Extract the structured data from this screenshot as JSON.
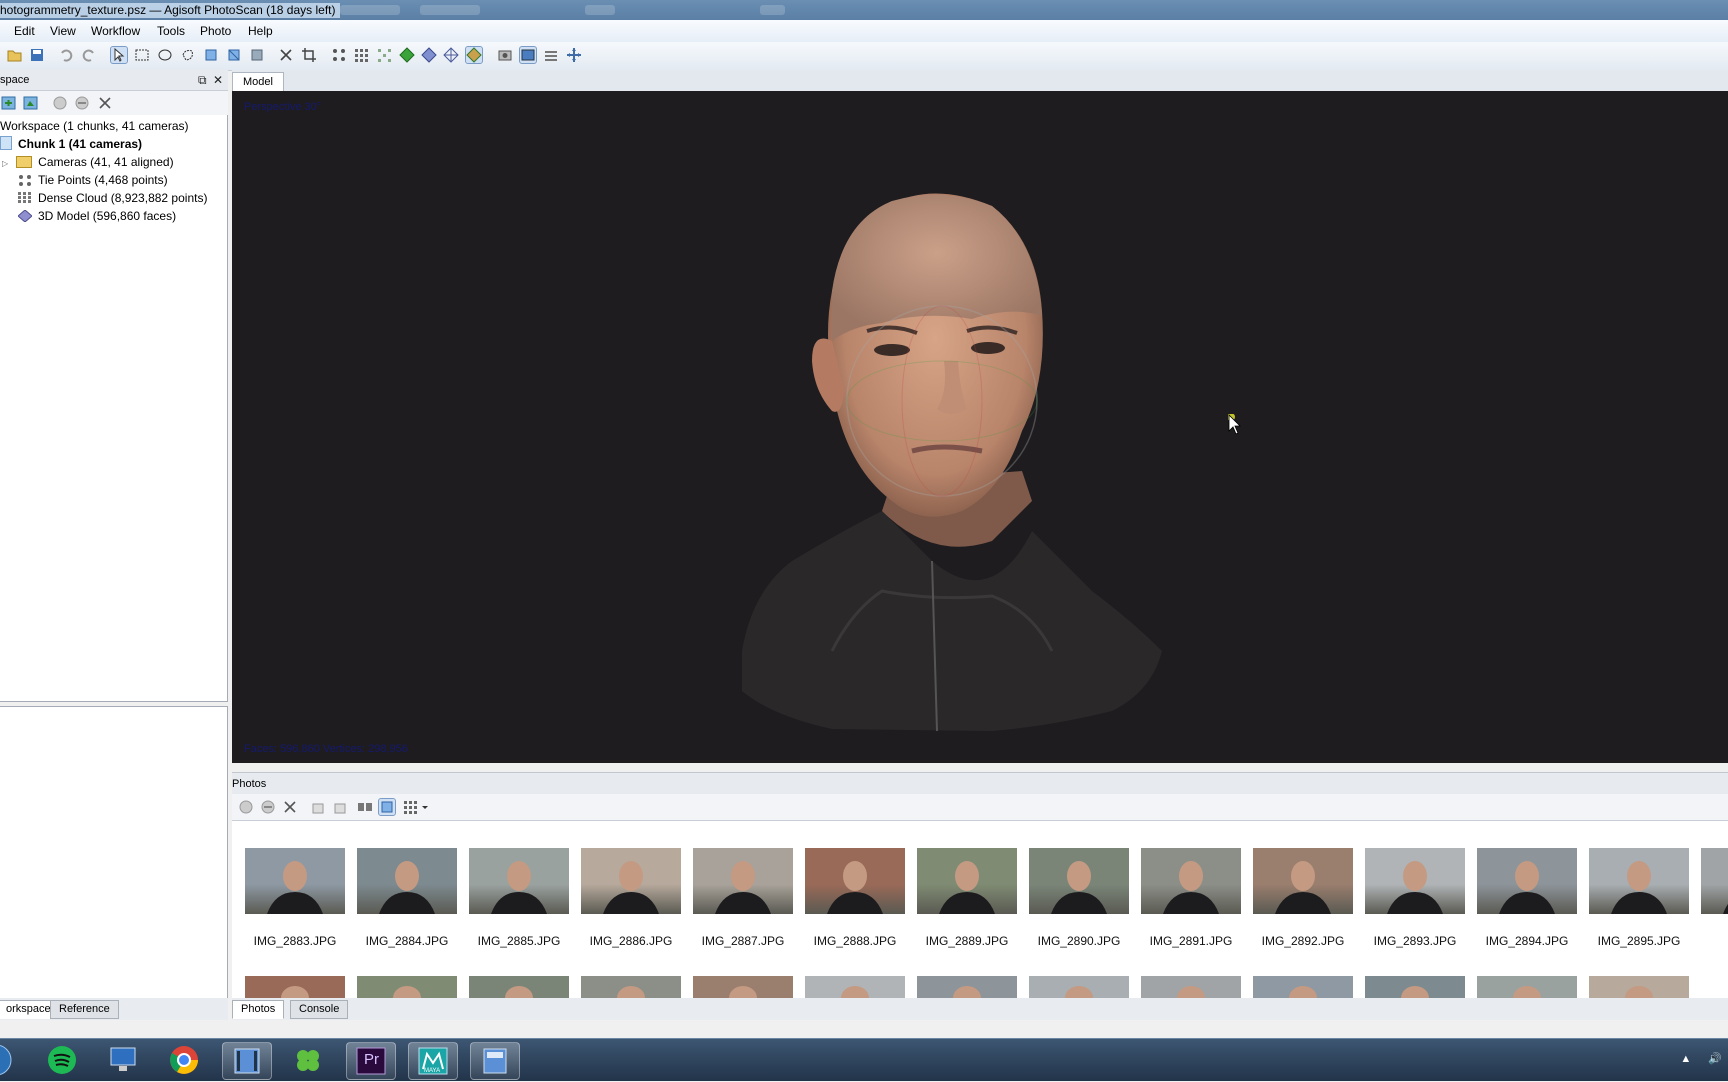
{
  "window": {
    "title": "hotogrammetry_texture.psz — Agisoft PhotoScan (18 days left)"
  },
  "menu": [
    "Edit",
    "View",
    "Workflow",
    "Tools",
    "Photo",
    "Help"
  ],
  "workspace": {
    "pane_title": "space",
    "tree": {
      "root": "Workspace (1 chunks, 41 cameras)",
      "chunk": "Chunk 1 (41 cameras)",
      "cameras": "Cameras (41, 41 aligned)",
      "tie_points": "Tie Points (4,468 points)",
      "dense_cloud": "Dense Cloud (8,923,882 points)",
      "model": "3D Model (596,860 faces)"
    },
    "tabs": {
      "workspace": "orkspace",
      "reference": "Reference"
    }
  },
  "model_view": {
    "tab": "Model",
    "overlay_top": "Perspective 30°",
    "overlay_bottom": "Faces: 596,860 Vertices: 298,956"
  },
  "photos": {
    "pane_title": "Photos",
    "thumbnails": [
      "IMG_2883.JPG",
      "IMG_2884.JPG",
      "IMG_2885.JPG",
      "IMG_2886.JPG",
      "IMG_2887.JPG",
      "IMG_2888.JPG",
      "IMG_2889.JPG",
      "IMG_2890.JPG",
      "IMG_2891.JPG",
      "IMG_2892.JPG",
      "IMG_2893.JPG",
      "IMG_2894.JPG",
      "IMG_2895.JPG",
      "IM"
    ],
    "tabs": {
      "photos": "Photos",
      "console": "Console"
    }
  },
  "taskbar": {
    "apps": [
      "start-orb",
      "spotify",
      "computer",
      "chrome",
      "video-editor",
      "clover",
      "premiere",
      "maya",
      "media-player"
    ],
    "premiere_label": "Pr",
    "maya_label": "MAYA"
  }
}
